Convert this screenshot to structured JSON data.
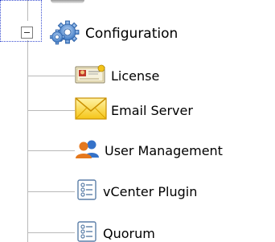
{
  "tree": {
    "root": {
      "label": "Configuration",
      "expanded": true,
      "icon": "gears-icon"
    },
    "children": [
      {
        "label": "License",
        "icon": "license-certificate-icon"
      },
      {
        "label": "Email Server",
        "icon": "envelope-icon"
      },
      {
        "label": "User Management",
        "icon": "users-icon"
      },
      {
        "label": "vCenter Plugin",
        "icon": "plugin-list-icon"
      },
      {
        "label": "Quorum",
        "icon": "plugin-list-icon"
      }
    ]
  },
  "colors": {
    "tree_line": "#b9b9b9",
    "focus_border": "#3a4fd1",
    "gear": "#3b78c4",
    "envelope": "#f5c518",
    "user_blue": "#3572c9",
    "user_orange": "#e5781d"
  }
}
